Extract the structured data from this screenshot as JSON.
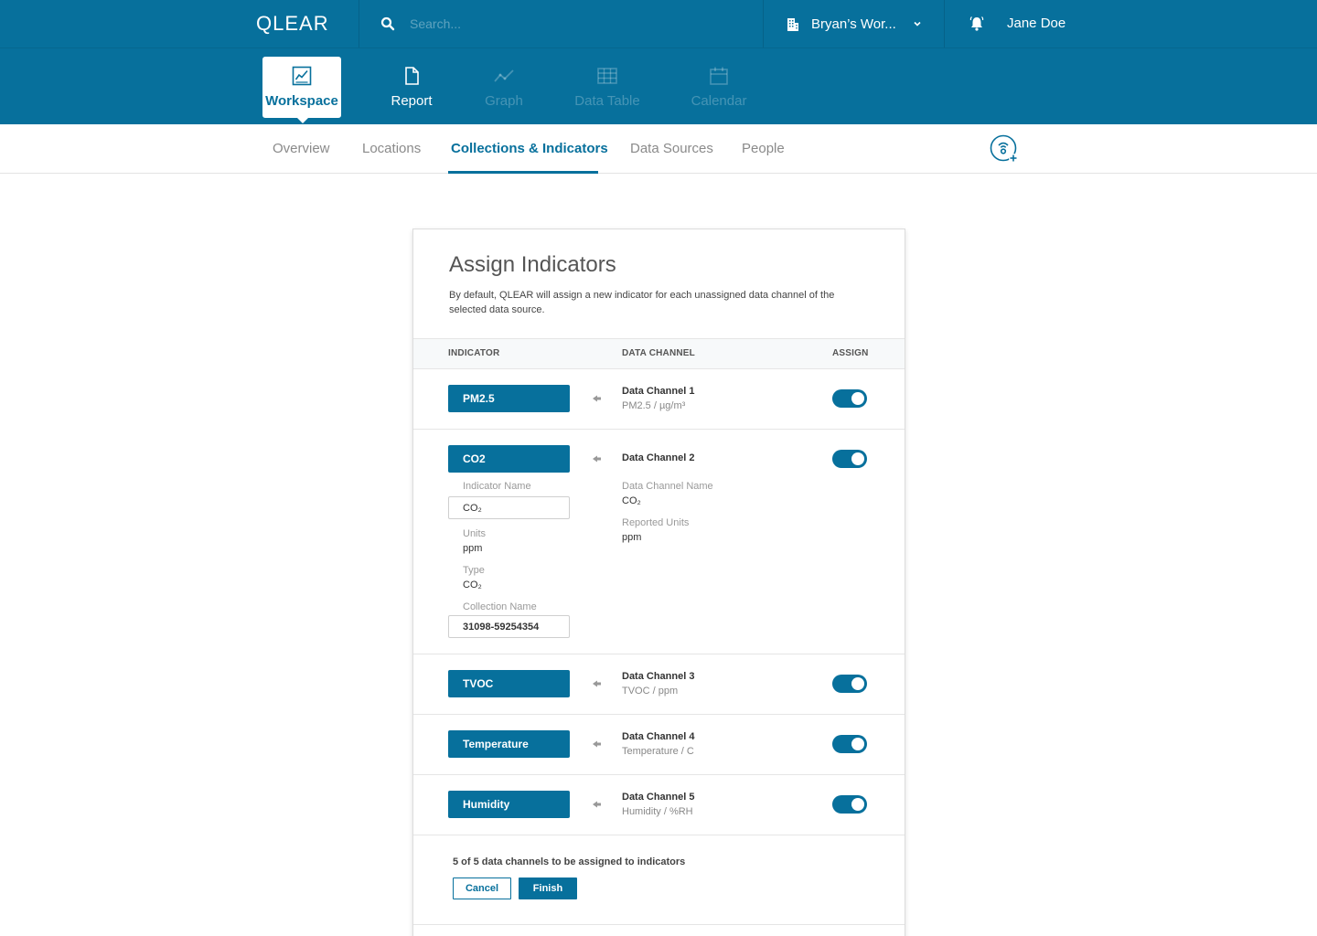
{
  "app": {
    "logo": "QLEAR"
  },
  "search": {
    "placeholder": "Search..."
  },
  "workspace": {
    "name": "Bryan’s Wor..."
  },
  "user": {
    "name": "Jane Doe"
  },
  "modules": [
    {
      "label": "Workspace",
      "icon": "workspace-chart-icon",
      "state": "active"
    },
    {
      "label": "Report",
      "icon": "document-icon",
      "state": "enabled"
    },
    {
      "label": "Graph",
      "icon": "line-graph-icon",
      "state": "disabled"
    },
    {
      "label": "Data Table",
      "icon": "table-grid-icon",
      "state": "disabled"
    },
    {
      "label": "Calendar",
      "icon": "calendar-icon",
      "state": "disabled"
    }
  ],
  "subnav": {
    "tabs": [
      "Overview",
      "Locations",
      "Collections & Indicators",
      "Data Sources",
      "People"
    ],
    "active": "Collections & Indicators"
  },
  "card": {
    "title": "Assign Indicators",
    "description": "By default, QLEAR will assign a new indicator for each unassigned data channel of the selected data source.",
    "columns": {
      "indicator": "INDICATOR",
      "channel": "DATA CHANNEL",
      "assign": "ASSIGN"
    },
    "rows": [
      {
        "indicator": "PM2.5",
        "channel": "Data Channel 1",
        "detail": "PM2.5 / µg/m³",
        "assigned": true
      },
      {
        "indicator": "CO2",
        "channel": "Data Channel 2",
        "detail": "",
        "assigned": true
      },
      {
        "indicator": "TVOC",
        "channel": "Data Channel 3",
        "detail": "TVOC / ppm",
        "assigned": true
      },
      {
        "indicator": "Temperature",
        "channel": "Data Channel 4",
        "detail": "Temperature / C",
        "assigned": true
      },
      {
        "indicator": "Humidity",
        "channel": "Data Channel 5",
        "detail": "Humidity / %RH",
        "assigned": true
      }
    ],
    "expanded": {
      "indicator_name_label": "Indicator Name",
      "indicator_name_value": "CO₂",
      "units_label": "Units",
      "units_value": "ppm",
      "type_label": "Type",
      "type_value": "CO₂",
      "collection_name_label": "Collection Name",
      "collection_name_value": "31098-59254354",
      "channel_name_label": "Data Channel Name",
      "channel_name_value": "CO₂",
      "reported_units_label": "Reported Units",
      "reported_units_value": "ppm"
    },
    "footer": {
      "summary": "5 of 5 data channels to be assigned to indicators",
      "cancel": "Cancel",
      "finish": "Finish"
    }
  },
  "colors": {
    "brand": "#07709c",
    "background": "#ffffff",
    "muted_text": "#8a8a8a"
  }
}
